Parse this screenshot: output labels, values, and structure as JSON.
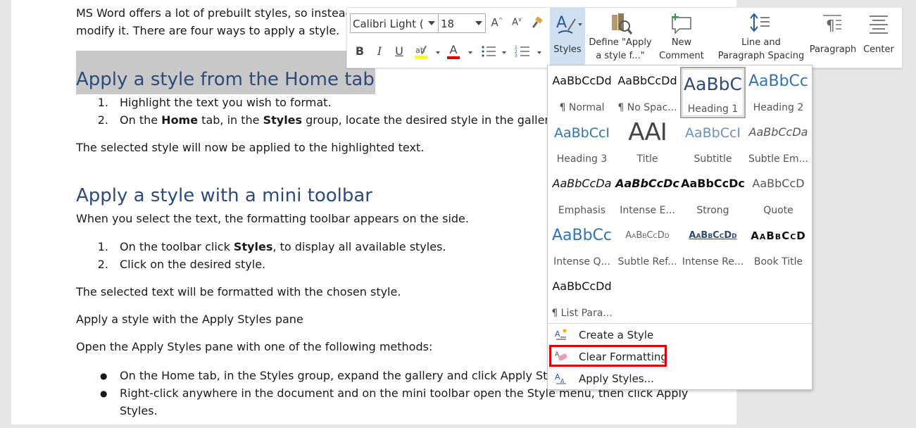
{
  "document": {
    "intro_line1": "MS Word offers a lot of prebuilt styles, so instead",
    "intro_line2": "modify it. There are four ways to apply a style.",
    "heading1": "Apply a style from the Home tab",
    "list1": [
      {
        "num": "1.",
        "text": "Highlight the text you wish to format."
      },
      {
        "num": "2.",
        "pre": "On the ",
        "b1": "Home",
        "mid": " tab, in the ",
        "b2": "Styles",
        "post": " group, locate the desired style in the gallery, ar"
      }
    ],
    "para1": "The selected style will now be applied to the highlighted text.",
    "heading2": "Apply a style with a mini toolbar",
    "para2": "When you select the text, the formatting toolbar appears on the side.",
    "list2": [
      {
        "num": "1.",
        "pre": "On the toolbar click ",
        "b1": "Styles",
        "post": ", to display all available styles."
      },
      {
        "num": "2.",
        "text": "Click on the desired style."
      }
    ],
    "para3": "The selected text will be formatted with the chosen style.",
    "para4": "Apply a style with the Apply Styles pane",
    "para5": "Open the Apply Styles pane with one of the following methods:",
    "bullets": [
      "On the Home tab, in the Styles group, expand the gallery and click Apply Styles",
      "Right-click anywhere in the document and on the mini toolbar open the Style menu, then click Apply",
      "Styles."
    ]
  },
  "mini_toolbar": {
    "font_name": "Calibri Light (H",
    "font_size": "18",
    "grow_font": "A",
    "shrink_font": "A",
    "bold": "B",
    "italic": "I",
    "underline": "U",
    "font_color_letter": "A",
    "styles_label": "Styles",
    "define_label_1": "Define \"Apply",
    "define_label_2": "a style f...\"",
    "new_comment_1": "New",
    "new_comment_2": "Comment",
    "line_spacing_1": "Line and",
    "line_spacing_2": "Paragraph Spacing",
    "paragraph_label": "Paragraph",
    "center_label": "Center",
    "highlight_color": "#ffff00",
    "font_color": "#e00000"
  },
  "styles_gallery": {
    "styles": [
      {
        "sample": "AaBbCcDd",
        "name": "¶ Normal"
      },
      {
        "sample": "AaBbCcDd",
        "name": "¶ No Spac..."
      },
      {
        "sample": "AaBbC",
        "name": "Heading 1"
      },
      {
        "sample": "AaBbCc",
        "name": "Heading 2"
      },
      {
        "sample": "AaBbCcI",
        "name": "Heading 3"
      },
      {
        "sample": "AAI",
        "name": "Title"
      },
      {
        "sample": "AaBbCcI",
        "name": "Subtitle"
      },
      {
        "sample": "AaBbCcDa",
        "name": "Subtle Em..."
      },
      {
        "sample": "AaBbCcDa",
        "name": "Emphasis"
      },
      {
        "sample": "AaBbCcDc",
        "name": "Intense E..."
      },
      {
        "sample": "AaBbCcDc",
        "name": "Strong"
      },
      {
        "sample": "AaBbCcD",
        "name": "Quote"
      },
      {
        "sample": "AaBbCc",
        "name": "Intense Q..."
      },
      {
        "sample": "AaBbCcDd",
        "name": "Subtle Ref..."
      },
      {
        "sample": "AaBbCcDd",
        "name": "Intense Re..."
      },
      {
        "sample": "AaBbCcD",
        "name": "Book Title"
      },
      {
        "sample": "AaBbCcDd",
        "name": "¶ List Para..."
      }
    ],
    "selected_style": "Heading 1",
    "menu": {
      "create_style": "Create a Style",
      "clear_formatting": "Clear Formatting",
      "apply_styles": "Apply Styles..."
    },
    "highlight_box_color": "#e00000"
  }
}
